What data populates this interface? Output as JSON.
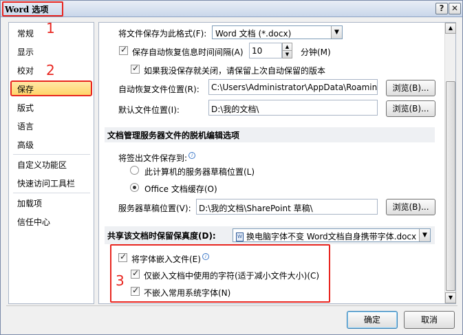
{
  "window": {
    "title": "Word 选项",
    "help": "?",
    "close": "✕"
  },
  "annotations": [
    "1",
    "2",
    "3"
  ],
  "sidebar": {
    "items": [
      "常规",
      "显示",
      "校对",
      "保存",
      "版式",
      "语言",
      "高级",
      "自定义功能区",
      "快速访问工具栏",
      "加载项",
      "信任中心"
    ],
    "selected": "保存"
  },
  "save": {
    "format_label": "将文件保存为此格式(F):",
    "format_value": "Word 文档 (*.docx)",
    "autorecover_label": "保存自动恢复信息时间间隔(A)",
    "autorecover_value": "10",
    "minutes_label": "分钟(M)",
    "keep_last_label": "如果我没保存就关闭，请保留上次自动保留的版本",
    "autorecover_path_label": "自动恢复文件位置(R):",
    "autorecover_path": "C:\\Users\\Administrator\\AppData\\Roaming",
    "default_path_label": "默认文件位置(I):",
    "default_path": "D:\\我的文档\\",
    "browse1": "浏览(B)...",
    "browse2": "浏览(B)..."
  },
  "offline": {
    "header": "文档管理服务器文件的脱机编辑选项",
    "checkout_label": "将签出文件保存到:",
    "radio1": "此计算机的服务器草稿位置(L)",
    "radio2": "Office 文档缓存(O)",
    "drafts_label": "服务器草稿位置(V):",
    "drafts_path": "D:\\我的文档\\SharePoint 草稿\\",
    "browse3": "浏览(B)..."
  },
  "fidelity": {
    "label": "共享该文档时保留保真度(D):",
    "doc_value": "换电脑字体不变 Word文档自身携带字体.docx",
    "embed_fonts": "将字体嵌入文件(E)",
    "embed_used_only": "仅嵌入文档中使用的字符(适于减小文件大小)(C)",
    "no_common_fonts": "不嵌入常用系统字体(N)"
  },
  "footer": {
    "ok": "确定",
    "cancel": "取消"
  },
  "colors": {
    "annotation": "#e8251f",
    "selected_bg": "#ffd56a"
  }
}
